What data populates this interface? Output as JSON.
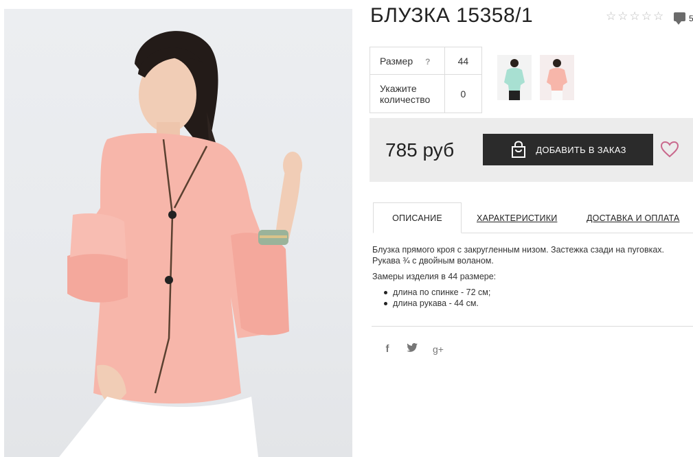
{
  "product": {
    "title": "БЛУЗКА 15358/1",
    "rating_stars": [
      "☆",
      "☆",
      "☆",
      "☆",
      "☆"
    ],
    "comments_count": "5",
    "image_icon": "product-photo"
  },
  "options": {
    "size_label": "Размер",
    "size_help": "?",
    "size_value": "44",
    "qty_label": "Укажите количество",
    "qty_value": "0"
  },
  "thumbnails": [
    {
      "icon": "thumbnail-mint-blouse"
    },
    {
      "icon": "thumbnail-pink-blouse"
    }
  ],
  "purchase": {
    "price": "785 руб",
    "add_button_label": "ДОБАВИТЬ В ЗАКАЗ",
    "bag_icon": "shopping-bag-icon",
    "wishlist_icon": "heart-icon"
  },
  "tabs": [
    {
      "label": "ОПИСАНИЕ",
      "active": true
    },
    {
      "label": "ХАРАКТЕРИСТИКИ",
      "active": false
    },
    {
      "label": "ДОСТАВКА И ОПЛАТА",
      "active": false
    }
  ],
  "description": {
    "text": "Блузка прямого кроя с закругленным низом. Застежка сзади на пуговках. Рукава ¾ с двойным воланом.",
    "measures_title": "Замеры изделия в 44 размере:",
    "measures": [
      "длина по спинке - 72 см;",
      "длина рукава - 44 см."
    ]
  },
  "social": {
    "facebook": "f",
    "twitter": "🐦",
    "googleplus": "g+"
  },
  "colors": {
    "blouse": "#f7b6aa",
    "button_bg": "#2b2b2b",
    "price_box_bg": "#ececec",
    "heart": "#c9688c"
  }
}
